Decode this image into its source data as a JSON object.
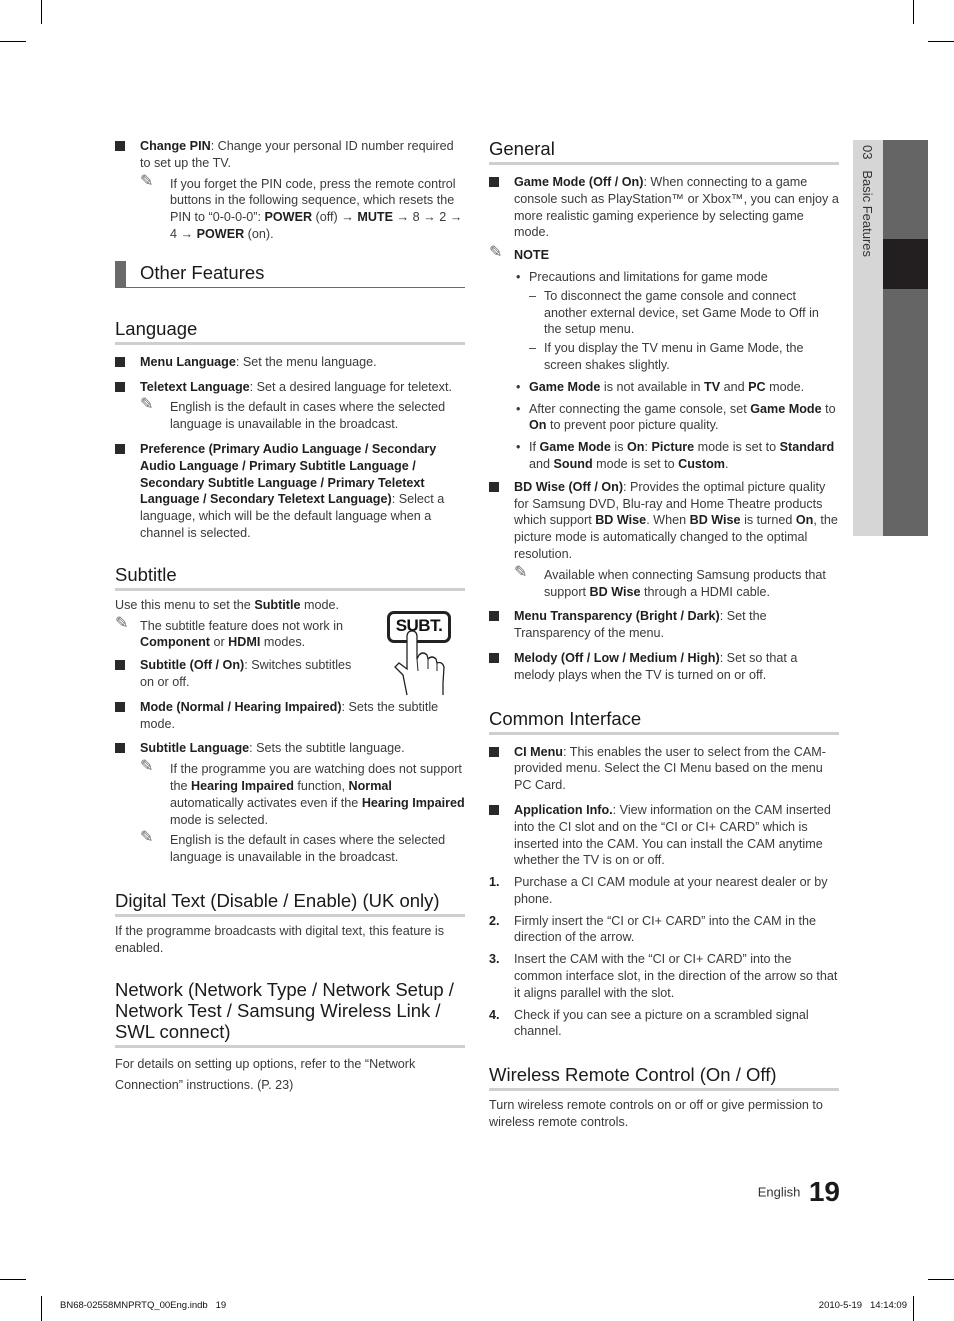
{
  "page": {
    "language": "English",
    "number": "19"
  },
  "side_tab": {
    "chapter": "03",
    "label": "Basic Features"
  },
  "footer": {
    "file": "BN68-02558MNPRTQ_00Eng.indb   19",
    "timestamp": "2010-5-19   14:14:09"
  },
  "left": {
    "change_pin": {
      "label": "Change PIN",
      "text": ": Change your personal ID number required to set up the TV.",
      "note": {
        "t1": "If you forget the PIN code, press the remote control buttons in the following sequence, which resets the PIN to “0-0-0-0”: ",
        "b1": "POWER",
        "t2": " (off) → ",
        "b2": "MUTE",
        "t3": " → 8 → 2 → 4 → ",
        "b3": "POWER",
        "t4": " (on)."
      }
    },
    "other_features_title": "Other Features",
    "language": {
      "title": "Language",
      "menu_language": {
        "label": "Menu Language",
        "text": ": Set the menu language."
      },
      "teletext_language": {
        "label": "Teletext Language",
        "text": ": Set a desired language for teletext."
      },
      "teletext_note": "English is the default in cases where the selected language is unavailable in the broadcast.",
      "preference": {
        "label": "Preference (Primary Audio Language / Secondary Audio Language / Primary Subtitle Language / Secondary Subtitle Language / Primary Teletext Language / Secondary Teletext Language)",
        "text": ": Select a language, which will be the default language when a channel is selected."
      }
    },
    "subtitle": {
      "title": "Subtitle",
      "intro": {
        "t1": "Use this menu to set the ",
        "b1": "Subtitle",
        "t2": " mode."
      },
      "note": {
        "t1": "The subtitle feature does not work in ",
        "b1": "Component",
        "t2": " or ",
        "b2": "HDMI",
        "t3": " modes."
      },
      "button_label": "SUBT.",
      "onoff": {
        "label": "Subtitle (Off / On)",
        "text": ": Switches subtitles on or off."
      },
      "mode": {
        "label": "Mode (Normal / Hearing Impaired)",
        "text": ": Sets the subtitle mode."
      },
      "sub_lang": {
        "label": "Subtitle Language",
        "text": ": Sets the subtitle language."
      },
      "note2": {
        "t1": "If the programme you are watching does not support the ",
        "b1": "Hearing Impaired",
        "t2": " function, ",
        "b2": "Normal",
        "t3": " automatically activates even if the ",
        "b3": "Hearing Impaired",
        "t4": " mode is selected."
      },
      "note3": "English is the default in cases where the selected language is unavailable in the broadcast."
    },
    "digital_text": {
      "title": "Digital Text (Disable / Enable) (UK only)",
      "text": "If the programme broadcasts with digital text, this feature is enabled."
    },
    "network": {
      "title": "Network (Network Type / Network Setup / Network Test / Samsung Wireless Link / SWL connect)",
      "text": "For details on setting up options, refer to the “Network Connection” instructions. (P. 23)"
    }
  },
  "right": {
    "general": {
      "title": "General",
      "game_mode": {
        "label": "Game Mode (Off / On)",
        "text": ": When connecting to a game console such as PlayStation™ or Xbox™, you can enjoy a more realistic gaming experience by selecting game mode."
      },
      "note_label": "NOTE",
      "precautions": "Precautions and limitations for game mode",
      "dash1": "To disconnect the game console and connect another external device, set Game Mode to Off in the setup menu.",
      "dash2": "If you display the TV menu in Game Mode, the screen shakes slightly.",
      "dot2": {
        "b1": "Game Mode",
        "t1": " is not available in ",
        "b2": "TV",
        "t2": " and ",
        "b3": "PC",
        "t3": " mode."
      },
      "dot3": {
        "t1": "After connecting the game console, set ",
        "b1": "Game Mode",
        "t2": " to ",
        "b2": "On",
        "t3": " to prevent poor picture quality."
      },
      "dot4": {
        "t1": "If ",
        "b1": "Game Mode",
        "t2": " is ",
        "b2": "On",
        "t3": ": ",
        "b3": "Picture",
        "t4": " mode is set to ",
        "b4": "Standard",
        "t5": " and ",
        "b5": "Sound",
        "t6": " mode is set to ",
        "b6": "Custom",
        "t7": "."
      },
      "bd_wise": {
        "label": "BD Wise (Off / On)",
        "t1": ": Provides the optimal picture quality for Samsung DVD, Blu-ray and Home Theatre products which support ",
        "b1": "BD Wise",
        "t2": ". When ",
        "b2": "BD Wise",
        "t3": " is turned ",
        "b3": "On",
        "t4": ", the picture mode is automatically changed to the optimal resolution."
      },
      "bd_note": {
        "t1": "Available when connecting Samsung products that support ",
        "b1": "BD Wise",
        "t2": " through a HDMI cable."
      },
      "menu_transparency": {
        "label": "Menu Transparency (Bright / Dark)",
        "text": ": Set the Transparency of the menu."
      },
      "melody": {
        "label": "Melody (Off / Low / Medium / High)",
        "text": ": Set so that a melody plays when the TV is turned on or off."
      }
    },
    "common_interface": {
      "title": "Common Interface",
      "ci_menu": {
        "label": "CI Menu",
        "text": ":  This enables the user to select from the CAM-provided menu. Select the CI Menu based on the menu PC Card."
      },
      "app_info": {
        "label": "Application Info.",
        "text": ": View information on the CAM inserted into the CI slot and on the “CI or CI+ CARD” which is inserted into the CAM. You can install the CAM anytime whether the TV is on or off."
      },
      "steps": [
        {
          "n": "1.",
          "text": "Purchase a CI CAM module at your nearest dealer or by phone."
        },
        {
          "n": "2.",
          "text": "Firmly insert the “CI or CI+ CARD” into the CAM in the direction of the arrow."
        },
        {
          "n": "3.",
          "text": "Insert the CAM with the “CI or CI+ CARD” into the common interface slot, in the direction of the arrow so that it aligns parallel with the slot."
        },
        {
          "n": "4.",
          "text": "Check if you can see a picture on a scrambled signal channel."
        }
      ]
    },
    "wireless": {
      "title": "Wireless Remote Control (On / Off)",
      "text": "Turn wireless remote controls on or off or give permission to wireless remote controls."
    }
  },
  "colors": {
    "tab_light": "#d6d6d6",
    "tab_dark": "#666566",
    "tab_active": "#231f20",
    "rule": "#cfcfcf"
  }
}
